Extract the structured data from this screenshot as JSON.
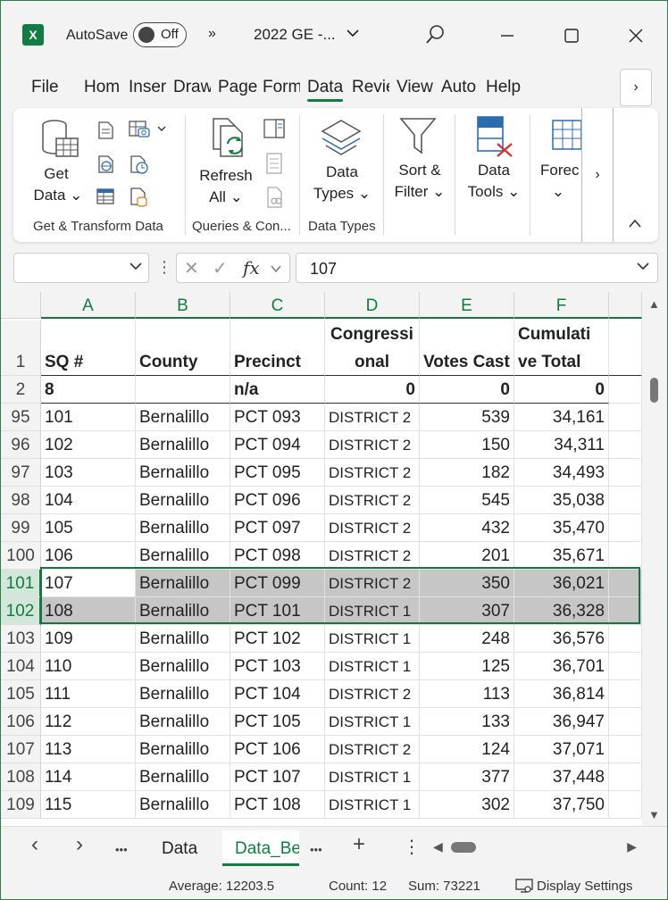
{
  "titlebar": {
    "app_icon": "excel-logo",
    "autosave_label": "AutoSave",
    "toggle_state": "Off",
    "more_chevron": "»",
    "doc_title": "2022 GE -...",
    "dropdown": "⌄"
  },
  "tabs": [
    "File",
    "Hom",
    "Inser",
    "Draw",
    "Page",
    "Form",
    "Data",
    "Revie",
    "View",
    "Auto",
    "Help"
  ],
  "active_tab": "Data",
  "tabs_more": "›",
  "ribbon": {
    "get_data": [
      "Get",
      "Data ⌄"
    ],
    "refresh_all": [
      "Refresh",
      "All ⌄"
    ],
    "data_types": [
      "Data",
      "Types ⌄"
    ],
    "sort_filter": [
      "Sort &",
      "Filter ⌄"
    ],
    "data_tools": [
      "Data",
      "Tools ⌄"
    ],
    "forecast": [
      "Forec",
      "⌄"
    ],
    "groups": [
      "Get & Transform Data",
      "Queries & Con...",
      "Data Types"
    ],
    "more": "›",
    "collapse": "^"
  },
  "formula_bar": {
    "name_box": "",
    "cancel": "✕",
    "enter": "✓",
    "fx": "fx",
    "value": "107"
  },
  "columns": [
    "A",
    "B",
    "C",
    "D",
    "E",
    "F"
  ],
  "header_row": {
    "row_num": "1",
    "cells": [
      "SQ #",
      "County",
      "Precinct",
      "Congressi onal",
      "Votes Cast",
      "Cumulati ve Total"
    ]
  },
  "row2": {
    "row_num": "2",
    "cells": [
      "8",
      "",
      "n/a",
      "0",
      "0",
      "0"
    ]
  },
  "rows": [
    {
      "n": "95",
      "a": "101",
      "b": "Bernalillo",
      "c": "PCT 093",
      "d": "DISTRICT 2",
      "e": "539",
      "f": "34,161"
    },
    {
      "n": "96",
      "a": "102",
      "b": "Bernalillo",
      "c": "PCT 094",
      "d": "DISTRICT 2",
      "e": "150",
      "f": "34,311"
    },
    {
      "n": "97",
      "a": "103",
      "b": "Bernalillo",
      "c": "PCT 095",
      "d": "DISTRICT 2",
      "e": "182",
      "f": "34,493"
    },
    {
      "n": "98",
      "a": "104",
      "b": "Bernalillo",
      "c": "PCT 096",
      "d": "DISTRICT 2",
      "e": "545",
      "f": "35,038"
    },
    {
      "n": "99",
      "a": "105",
      "b": "Bernalillo",
      "c": "PCT 097",
      "d": "DISTRICT 2",
      "e": "432",
      "f": "35,470"
    },
    {
      "n": "100",
      "a": "106",
      "b": "Bernalillo",
      "c": "PCT 098",
      "d": "DISTRICT 2",
      "e": "201",
      "f": "35,671"
    },
    {
      "n": "101",
      "a": "107",
      "b": "Bernalillo",
      "c": "PCT 099",
      "d": "DISTRICT 2",
      "e": "350",
      "f": "36,021"
    },
    {
      "n": "102",
      "a": "108",
      "b": "Bernalillo",
      "c": "PCT 101",
      "d": "DISTRICT 1",
      "e": "307",
      "f": "36,328"
    },
    {
      "n": "103",
      "a": "109",
      "b": "Bernalillo",
      "c": "PCT 102",
      "d": "DISTRICT 1",
      "e": "248",
      "f": "36,576"
    },
    {
      "n": "104",
      "a": "110",
      "b": "Bernalillo",
      "c": "PCT 103",
      "d": "DISTRICT 1",
      "e": "125",
      "f": "36,701"
    },
    {
      "n": "105",
      "a": "111",
      "b": "Bernalillo",
      "c": "PCT 104",
      "d": "DISTRICT 2",
      "e": "113",
      "f": "36,814"
    },
    {
      "n": "106",
      "a": "112",
      "b": "Bernalillo",
      "c": "PCT 105",
      "d": "DISTRICT 1",
      "e": "133",
      "f": "36,947"
    },
    {
      "n": "107",
      "a": "113",
      "b": "Bernalillo",
      "c": "PCT 106",
      "d": "DISTRICT 2",
      "e": "124",
      "f": "37,071"
    },
    {
      "n": "108",
      "a": "114",
      "b": "Bernalillo",
      "c": "PCT 107",
      "d": "DISTRICT 1",
      "e": "377",
      "f": "37,448"
    },
    {
      "n": "109",
      "a": "115",
      "b": "Bernalillo",
      "c": "PCT 108",
      "d": "DISTRICT 1",
      "e": "302",
      "f": "37,750"
    }
  ],
  "selected_rows": [
    "101",
    "102"
  ],
  "sheetbar": {
    "prev": "‹",
    "next": "›",
    "more_left": "•••",
    "tabs": [
      "Data",
      "Data_Be"
    ],
    "active_sheet": "Data_Be",
    "more_right": "•••",
    "add": "+",
    "options": "⋮"
  },
  "statusbar": {
    "average": "Average: 12203.5",
    "count": "Count: 12",
    "sum": "Sum: 73221",
    "display_settings": "Display Settings"
  },
  "colors": {
    "accent": "#107c41",
    "selection_fill": "#c6c6c6",
    "window_bg": "#f3f3f3"
  }
}
